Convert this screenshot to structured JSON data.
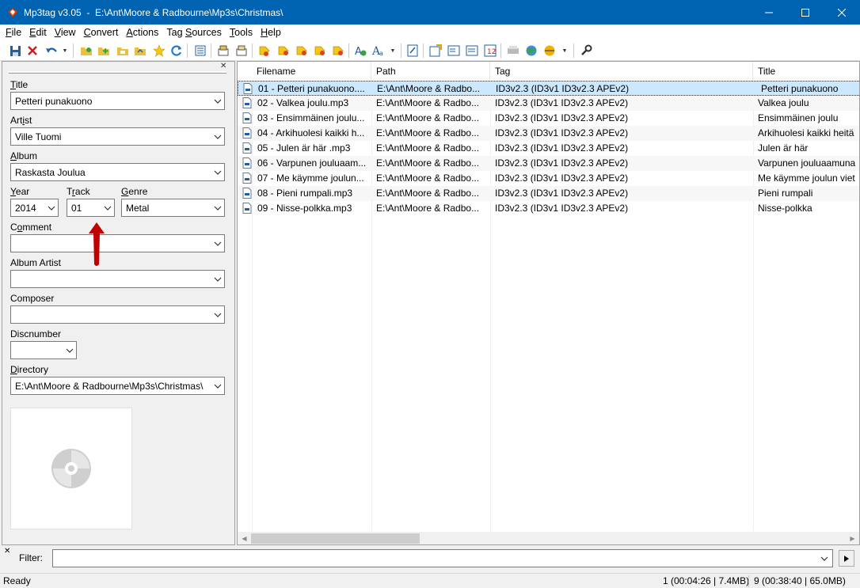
{
  "window": {
    "title": "Mp3tag v3.05  -  E:\\Ant\\Moore & Radbourne\\Mp3s\\Christmas\\"
  },
  "menu": [
    {
      "pre": "",
      "u": "F",
      "post": "ile"
    },
    {
      "pre": "",
      "u": "E",
      "post": "dit"
    },
    {
      "pre": "",
      "u": "V",
      "post": "iew"
    },
    {
      "pre": "",
      "u": "C",
      "post": "onvert"
    },
    {
      "pre": "",
      "u": "A",
      "post": "ctions"
    },
    {
      "pre": "Tag ",
      "u": "S",
      "post": "ources"
    },
    {
      "pre": "",
      "u": "T",
      "post": "ools"
    },
    {
      "pre": "",
      "u": "H",
      "post": "elp"
    }
  ],
  "panel": {
    "title": {
      "label_u": "T",
      "label_rest": "itle",
      "value": "Petteri punakuono"
    },
    "artist": {
      "label_pre": "Art",
      "label_u": "i",
      "label_rest": "st",
      "value": "Ville Tuomi"
    },
    "album": {
      "label_u": "A",
      "label_rest": "lbum",
      "value": "Raskasta Joulua"
    },
    "year": {
      "label_u": "Y",
      "label_rest": "ear",
      "value": "2014"
    },
    "track": {
      "label_pre": "T",
      "label_u": "r",
      "label_rest": "ack",
      "value": "01"
    },
    "genre": {
      "label_u": "G",
      "label_rest": "enre",
      "value": "Metal"
    },
    "comment": {
      "label_pre": "C",
      "label_u": "o",
      "label_rest": "mment",
      "value": ""
    },
    "album_artist": {
      "label": "Album Artist",
      "value": ""
    },
    "composer": {
      "label": "Composer",
      "value": ""
    },
    "discnumber": {
      "label": "Discnumber",
      "value": ""
    },
    "directory": {
      "label_u": "D",
      "label_rest": "irectory",
      "value": "E:\\Ant\\Moore & Radbourne\\Mp3s\\Christmas\\"
    }
  },
  "columns": [
    "Filename",
    "Path",
    "Tag",
    "Title"
  ],
  "rows": [
    {
      "filename": "01 -  Petteri punakuono....",
      "path": "E:\\Ant\\Moore & Radbo...",
      "tag": "ID3v2.3 (ID3v1 ID3v2.3 APEv2)",
      "title": "Petteri punakuono"
    },
    {
      "filename": "02 - Valkea joulu.mp3",
      "path": "E:\\Ant\\Moore & Radbo...",
      "tag": "ID3v2.3 (ID3v1 ID3v2.3 APEv2)",
      "title": "Valkea joulu"
    },
    {
      "filename": "03 - Ensimmäinen joulu...",
      "path": "E:\\Ant\\Moore & Radbo...",
      "tag": "ID3v2.3 (ID3v1 ID3v2.3 APEv2)",
      "title": "Ensimmäinen joulu"
    },
    {
      "filename": "04 - Arkihuolesi kaikki h...",
      "path": "E:\\Ant\\Moore & Radbo...",
      "tag": "ID3v2.3 (ID3v1 ID3v2.3 APEv2)",
      "title": "Arkihuolesi kaikki heitä"
    },
    {
      "filename": "05 - Julen är här .mp3",
      "path": "E:\\Ant\\Moore & Radbo...",
      "tag": "ID3v2.3 (ID3v1 ID3v2.3 APEv2)",
      "title": "Julen är här"
    },
    {
      "filename": "06 - Varpunen jouluaam...",
      "path": "E:\\Ant\\Moore & Radbo...",
      "tag": "ID3v2.3 (ID3v1 ID3v2.3 APEv2)",
      "title": "Varpunen jouluaamuna"
    },
    {
      "filename": "07 - Me käymme joulun...",
      "path": "E:\\Ant\\Moore & Radbo...",
      "tag": "ID3v2.3 (ID3v1 ID3v2.3 APEv2)",
      "title": "Me käymme joulun viet"
    },
    {
      "filename": "08 - Pieni rumpali.mp3",
      "path": "E:\\Ant\\Moore & Radbo...",
      "tag": "ID3v2.3 (ID3v1 ID3v2.3 APEv2)",
      "title": "Pieni rumpali"
    },
    {
      "filename": "09 - Nisse-polkka.mp3",
      "path": "E:\\Ant\\Moore & Radbo...",
      "tag": "ID3v2.3 (ID3v1 ID3v2.3 APEv2)",
      "title": "Nisse-polkka"
    }
  ],
  "filter": {
    "label": "Filter:",
    "value": ""
  },
  "status": {
    "ready": "Ready",
    "selected": "1 (00:04:26 | 7.4MB)",
    "total": "9 (00:38:40 | 65.0MB)"
  },
  "colors": {
    "titlebar": "#0063b1",
    "selection": "#cce8ff",
    "annotation_arrow": "#c00000"
  }
}
